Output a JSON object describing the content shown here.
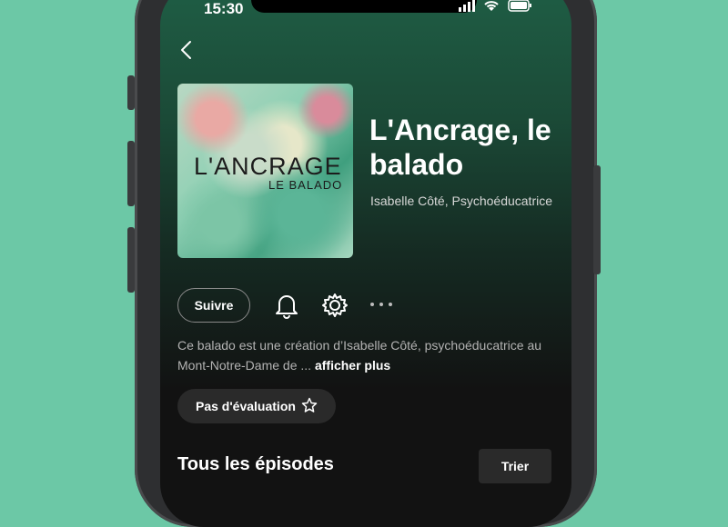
{
  "status_bar": {
    "time": "15:30"
  },
  "podcast": {
    "cover_title": "L'ANCRAGE",
    "cover_subtitle": "LE BALADO",
    "title": "L'Ancrage, le balado",
    "author": "Isabelle Côté, Psychoéducatrice",
    "follow_label": "Suivre",
    "description": "Ce balado est une création d’Isabelle Côté, psychoéducatrice au Mont-Notre-Dame de ...",
    "more_label": "afficher plus",
    "rating_label": "Pas d'évaluation"
  },
  "episodes": {
    "title": "Tous les épisodes",
    "sort_label": "Trier"
  },
  "colors": {
    "background": "#6cc8a6",
    "header_gradient_top": "#1f5e45",
    "surface": "#121212"
  },
  "icons": [
    "back-icon",
    "bell-icon",
    "gear-icon",
    "more-icon",
    "star-icon",
    "signal-icon",
    "wifi-icon",
    "battery-icon"
  ]
}
